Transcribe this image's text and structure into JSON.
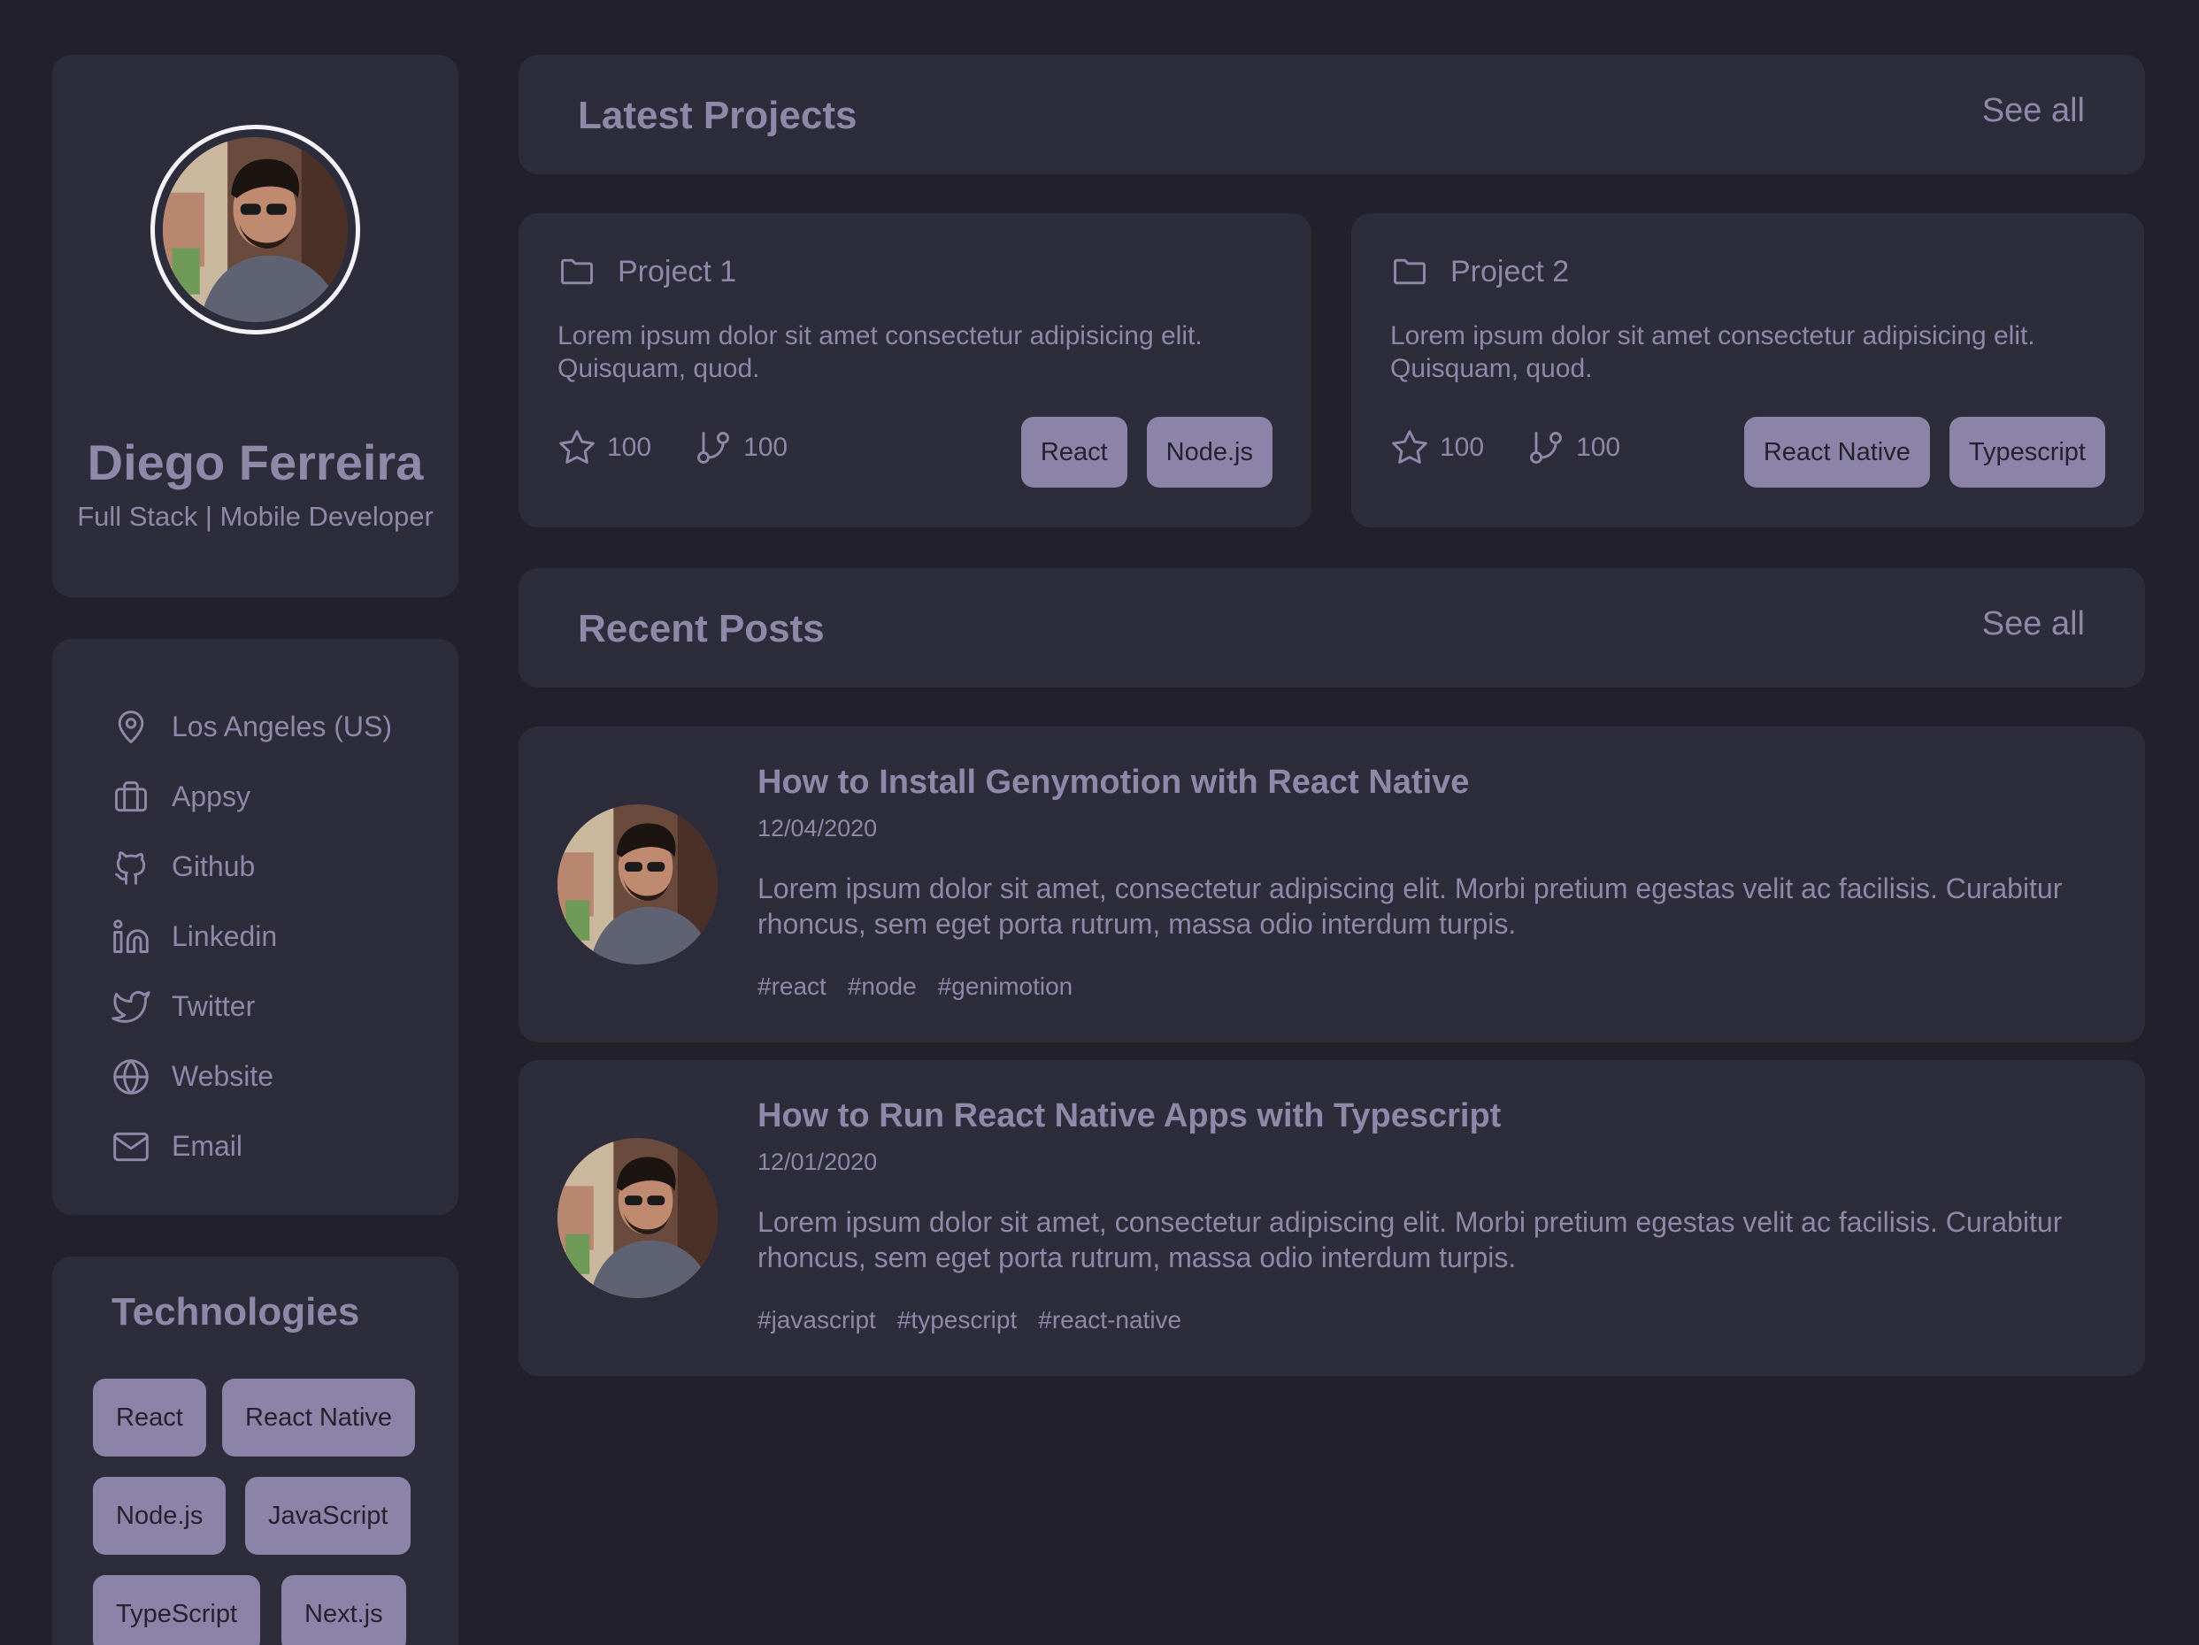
{
  "theme": {
    "background": "#21202b",
    "card": "#2d2c3b",
    "text": "#8f88a8",
    "tag_bg": "#8c84a8",
    "tag_text": "#24222e"
  },
  "profile": {
    "name": "Diego Ferreira",
    "role": "Full Stack | Mobile Developer"
  },
  "info": {
    "location": "Los Angeles (US)",
    "company": "Appsy",
    "github": "Github",
    "linkedin": "Linkedin",
    "twitter": "Twitter",
    "website": "Website",
    "email": "Email"
  },
  "technologies": {
    "title": "Technologies",
    "items": [
      "React",
      "React Native",
      "Node.js",
      "JavaScript",
      "TypeScript",
      "Next.js"
    ]
  },
  "projects": {
    "title": "Latest Projects",
    "see_all": "See all",
    "items": [
      {
        "name": "Project 1",
        "description": "Lorem ipsum dolor sit amet consectetur adipisicing elit. Quisquam, quod.",
        "stars": "100",
        "forks": "100",
        "tags": [
          "React",
          "Node.js"
        ]
      },
      {
        "name": "Project 2",
        "description": "Lorem ipsum dolor sit amet consectetur adipisicing elit. Quisquam, quod.",
        "stars": "100",
        "forks": "100",
        "tags": [
          "React Native",
          "Typescript"
        ]
      }
    ]
  },
  "posts": {
    "title": "Recent Posts",
    "see_all": "See all",
    "items": [
      {
        "title": "How to Install Genymotion with React Native",
        "date": "12/04/2020",
        "body": "Lorem ipsum dolor sit amet, consectetur adipiscing elit. Morbi pretium egestas velit ac facilisis. Curabitur rhoncus, sem eget porta rutrum, massa odio interdum turpis.",
        "tags": [
          "#react",
          "#node",
          "#genimotion"
        ]
      },
      {
        "title": "How to Run React Native Apps with Typescript",
        "date": "12/01/2020",
        "body": "Lorem ipsum dolor sit amet, consectetur adipiscing elit. Morbi pretium egestas velit ac facilisis. Curabitur rhoncus, sem eget porta rutrum, massa odio interdum turpis.",
        "tags": [
          "#javascript",
          "#typescript",
          "#react-native"
        ]
      }
    ]
  }
}
